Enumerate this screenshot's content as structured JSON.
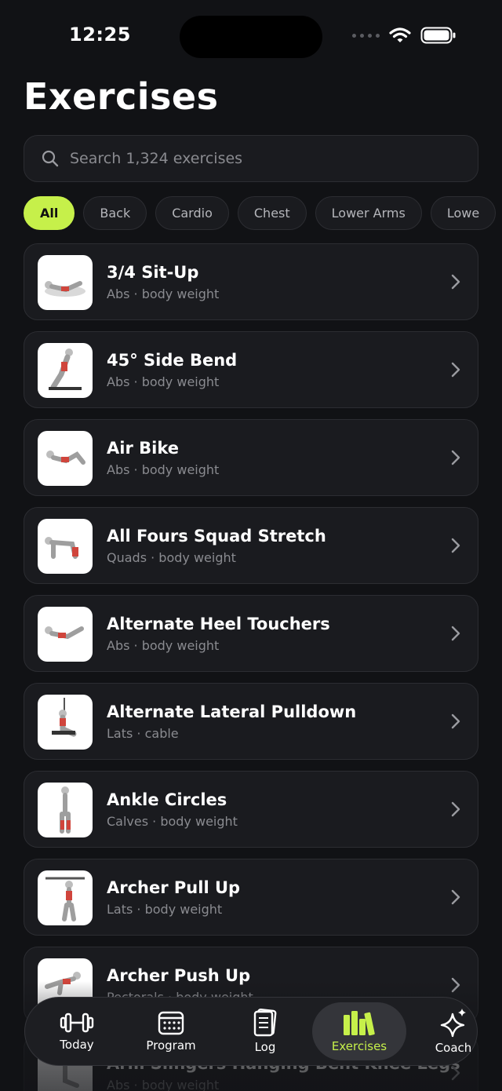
{
  "status_bar": {
    "time": "12:25"
  },
  "page": {
    "title": "Exercises"
  },
  "search": {
    "placeholder": "Search 1,324 exercises"
  },
  "filters": [
    "All",
    "Back",
    "Cardio",
    "Chest",
    "Lower Arms",
    "Lowe"
  ],
  "exercises": [
    {
      "name": "3/4 Sit-Up",
      "meta": "Abs · body weight"
    },
    {
      "name": "45° Side Bend",
      "meta": "Abs · body weight"
    },
    {
      "name": "Air Bike",
      "meta": "Abs · body weight"
    },
    {
      "name": "All Fours Squad Stretch",
      "meta": "Quads · body weight"
    },
    {
      "name": "Alternate Heel Touchers",
      "meta": "Abs · body weight"
    },
    {
      "name": "Alternate Lateral Pulldown",
      "meta": "Lats · cable"
    },
    {
      "name": "Ankle Circles",
      "meta": "Calves · body weight"
    },
    {
      "name": "Archer Pull Up",
      "meta": "Lats · body weight"
    },
    {
      "name": "Archer Push Up",
      "meta": "Pectorals · body weight"
    },
    {
      "name": "Arm Slingers Hanging Bent Knee Legs",
      "meta": "Abs · body weight"
    }
  ],
  "tabs": [
    {
      "label": "Today",
      "icon": "dumbbell-icon"
    },
    {
      "label": "Program",
      "icon": "calendar-icon"
    },
    {
      "label": "Log",
      "icon": "notebook-icon"
    },
    {
      "label": "Exercises",
      "icon": "library-icon"
    },
    {
      "label": "Coach",
      "icon": "sparkle-icon"
    }
  ],
  "colors": {
    "accent": "#c6f04a",
    "background": "#111215",
    "card": "#1a1b1f"
  }
}
